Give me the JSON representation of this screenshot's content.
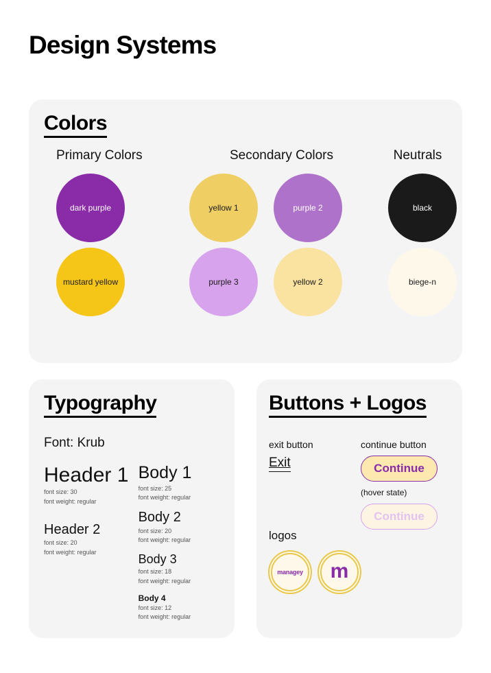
{
  "page": {
    "title": "Design Systems"
  },
  "colors": {
    "heading": "Colors",
    "groups": [
      {
        "label": "Primary Colors",
        "swatches": [
          {
            "name": "dark purple",
            "hex": "#8A2BA8",
            "text_color": "#FFFFFF"
          },
          {
            "name": "mustard yellow",
            "hex": "#F5C518",
            "text_color": "#1A1A1A"
          }
        ]
      },
      {
        "label": "Secondary Colors",
        "swatches": [
          {
            "name": "yellow 1",
            "hex": "#EFCE63",
            "text_color": "#1A1A1A"
          },
          {
            "name": "purple 2",
            "hex": "#AF72CA",
            "text_color": "#FFFFFF"
          },
          {
            "name": "purple 3",
            "hex": "#D7A3EC",
            "text_color": "#1A1A1A"
          },
          {
            "name": "yellow 2",
            "hex": "#FAE2A0",
            "text_color": "#1A1A1A"
          }
        ]
      },
      {
        "label": "Neutrals",
        "swatches": [
          {
            "name": "black",
            "hex": "#1A1A1A",
            "text_color": "#FFFFFF"
          },
          {
            "name": "biege-n",
            "hex": "#FDF8EA",
            "text_color": "#1A1A1A"
          }
        ]
      }
    ]
  },
  "typography": {
    "heading": "Typography",
    "font_line": "Font: Krub",
    "left_column": [
      {
        "sample": "Header 1",
        "size_line": "font size: 30",
        "weight_line": "font weight: regular"
      },
      {
        "sample": "Header 2",
        "size_line": "font size: 20",
        "weight_line": "font weight: regular"
      }
    ],
    "right_column": [
      {
        "sample": "Body 1",
        "size_line": "font size: 25",
        "weight_line": "font weight: regular"
      },
      {
        "sample": "Body 2",
        "size_line": "font size: 20",
        "weight_line": "font weight: regular"
      },
      {
        "sample": "Body 3",
        "size_line": "font size: 18",
        "weight_line": "font weight: regular"
      },
      {
        "sample": "Body 4",
        "size_line": "font size: 12",
        "weight_line": "font weight: regular"
      }
    ]
  },
  "buttons": {
    "heading": "Buttons + Logos",
    "exit": {
      "caption": "exit button",
      "label": "Exit"
    },
    "continue": {
      "caption": "continue button",
      "label": "Continue",
      "hover_note": "(hover state)",
      "hover_label": "Continue",
      "border_color": "#8A2BA8",
      "fill_color": "#FDE8B0",
      "text_color": "#8A2BA8"
    },
    "logos": {
      "caption": "logos",
      "items": [
        {
          "text": "managey",
          "style": "wordmark"
        },
        {
          "text": "m",
          "style": "monogram"
        }
      ],
      "ring_color": "#E8C84A",
      "fill_color": "#FDF8EA",
      "mark_color": "#8A2BA8"
    }
  }
}
